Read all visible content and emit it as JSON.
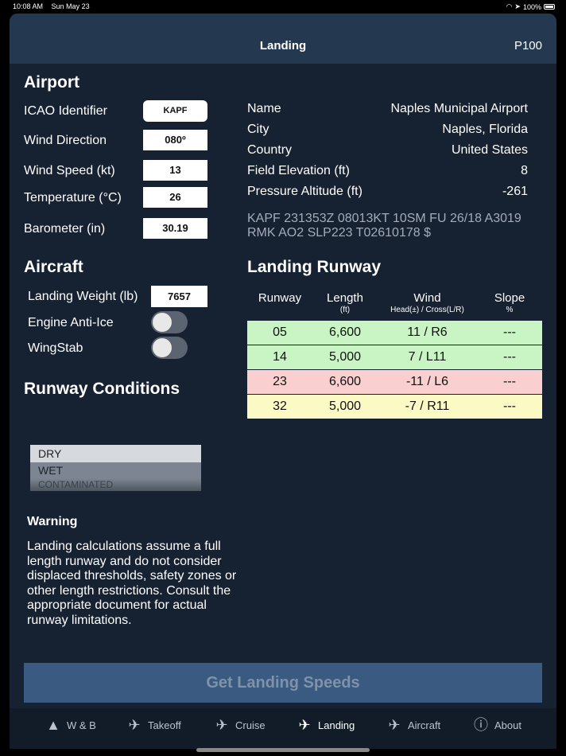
{
  "status": {
    "time": "10:08 AM",
    "date": "Sun May 23",
    "battery": "100%"
  },
  "nav": {
    "title": "Landing",
    "right": "P100"
  },
  "airport": {
    "title": "Airport",
    "fields": {
      "icao": {
        "label": "ICAO Identifier",
        "value": "KAPF"
      },
      "wind_dir": {
        "label": "Wind Direction",
        "value": "080º"
      },
      "wind_speed": {
        "label": "Wind Speed (kt)",
        "value": "13"
      },
      "temp": {
        "label": "Temperature (°C)",
        "value": "26"
      },
      "baro": {
        "label": "Barometer (in)",
        "value": "30.19"
      }
    },
    "info": {
      "name": {
        "label": "Name",
        "value": "Naples Municipal Airport"
      },
      "city": {
        "label": "City",
        "value": "Naples, Florida"
      },
      "country": {
        "label": "Country",
        "value": "United States"
      },
      "elev": {
        "label": "Field Elevation (ft)",
        "value": "8"
      },
      "pa": {
        "label": "Pressure Altitude (ft)",
        "value": "-261"
      }
    },
    "metar_line1": "KAPF 231353Z 08013KT 10SM FU 26/18 A3019",
    "metar_line2": "RMK AO2 SLP223 T02610178 $"
  },
  "aircraft": {
    "title": "Aircraft",
    "weight": {
      "label": "Landing Weight (lb)",
      "value": "7657"
    },
    "anti_ice": {
      "label": "Engine Anti-Ice",
      "on": false
    },
    "wingstab": {
      "label": "WingStab",
      "on": false
    }
  },
  "conditions": {
    "title": "Runway Conditions",
    "options": [
      "DRY",
      "WET",
      "CONTAMINATED"
    ],
    "selected": "DRY"
  },
  "runway": {
    "title": "Landing Runway",
    "headers": {
      "runway": "Runway",
      "length": "Length",
      "length_unit": "(ft)",
      "wind": "Wind",
      "wind_sub": "Head(±) / Cross(L/R)",
      "slope": "Slope",
      "slope_unit": "%"
    },
    "rows": [
      {
        "runway": "05",
        "length": "6,600",
        "wind": "11 / R6",
        "slope": "---",
        "color": "#c9f5c4"
      },
      {
        "runway": "14",
        "length": "5,000",
        "wind": "7 / L11",
        "slope": "---",
        "color": "#c9f5c4"
      },
      {
        "runway": "23",
        "length": "6,600",
        "wind": "-11 / L6",
        "slope": "---",
        "color": "#f9cfcf"
      },
      {
        "runway": "32",
        "length": "5,000",
        "wind": "-7 / R11",
        "slope": "---",
        "color": "#fbf9c4"
      }
    ]
  },
  "warning": {
    "title": "Warning",
    "text": "Landing calculations assume a full length runway and do not consider displaced thresholds, safety zones or other length restrictions. Consult the appropriate document for actual runway limitations."
  },
  "action": {
    "label": "Get Landing Speeds"
  },
  "tabs": [
    {
      "label": "W & B",
      "icon": "weight-icon"
    },
    {
      "label": "Takeoff",
      "icon": "takeoff-icon"
    },
    {
      "label": "Cruise",
      "icon": "cruise-icon"
    },
    {
      "label": "Landing",
      "icon": "landing-icon",
      "active": true
    },
    {
      "label": "Aircraft",
      "icon": "airplane-icon"
    },
    {
      "label": "About",
      "icon": "info-icon"
    }
  ]
}
